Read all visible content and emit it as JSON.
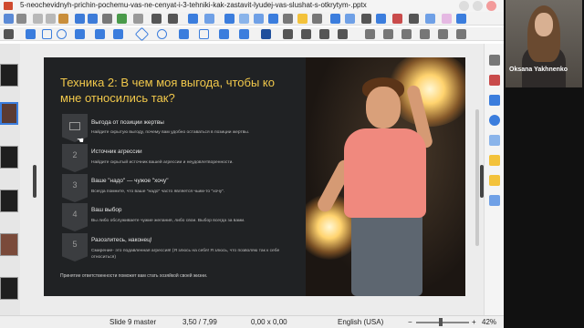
{
  "window": {
    "title": "5-neochevidnyh-prichin-pochemu-vas-ne-cenyat-i-3-tehniki-kak-zastavit-lyudej-vas-slushat-s-otkrytym-.pptx"
  },
  "toolbar": {
    "icons": [
      "save-icon",
      "print-icon",
      "undo-icon",
      "redo-icon",
      "spellcheck-icon",
      "text-box-icon",
      "table-icon",
      "image-icon",
      "chart-icon",
      "special-character-icon",
      "shapes-icon"
    ],
    "draw_icons": [
      "select-icon",
      "line-icon",
      "rectangle-icon",
      "ellipse-icon",
      "arrow-icon",
      "curve-icon",
      "connector-icon",
      "diamond-icon",
      "smiley-icon",
      "block-arrow-icon",
      "flowchart-icon",
      "callout-icon",
      "star-icon",
      "3d-object-icon",
      "rotate-icon",
      "align-icon",
      "arrange-icon",
      "shadow-icon",
      "crop-icon",
      "filter-icon"
    ]
  },
  "slide": {
    "title": "Техника 2: В чем моя выгода, чтобы ко мне относились так?",
    "steps": [
      {
        "num": "",
        "icon": "chart-icon",
        "heading": "Выгода от позиции жертвы",
        "desc": "Найдите скрытую выгоду, почему вам удобно оставаться в позиции жертвы."
      },
      {
        "num": "2",
        "heading": "Источник агрессии",
        "desc": "Найдите скрытый источник вашей агрессии и неудовлетворенности."
      },
      {
        "num": "3",
        "heading": "Ваше \"надо\" — чужое \"хочу\"",
        "desc": "Всегда помните, что ваше \"надо\" часто является чьим-то \"хочу\"."
      },
      {
        "num": "4",
        "heading": "Ваш выбор",
        "desc": "Вы либо обслуживаете чужие желания, либо свои. Выбор всегда за вами."
      },
      {
        "num": "5",
        "heading": "Разозлитесь, наконец!",
        "desc": "Смирение- это подавленная агрессия! (Я злюсь на себя! Я злюсь, что позволяю так к себе относиться)"
      }
    ],
    "footer": "Принятие ответственности поможет вам стать хозяйкой своей жизни."
  },
  "status": {
    "slide_master": "Slide 9 master",
    "position": "3,50 / 7,99",
    "size": "0,00 x 0,00",
    "language": "English (USA)",
    "zoom": "42%",
    "zoom_minus": "−",
    "zoom_plus": "+"
  },
  "webcam": {
    "name": "Oksana Yakhnenko"
  },
  "colors": {
    "title_accent": "#f1c84b",
    "slide_bg": "#202224",
    "selection": "#3b7ddd"
  }
}
